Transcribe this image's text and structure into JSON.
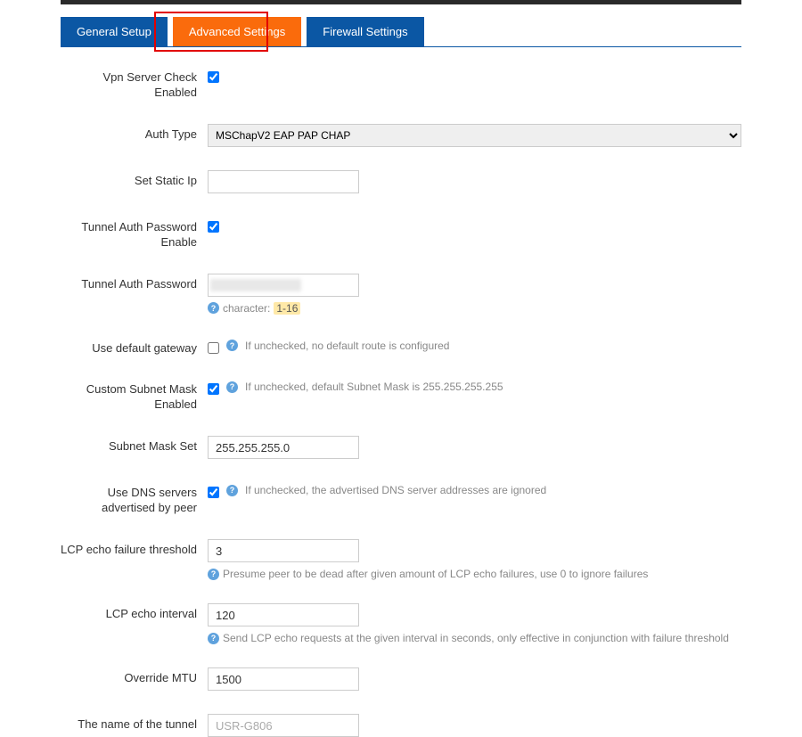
{
  "tabs": {
    "general": "General Setup",
    "advanced": "Advanced Settings",
    "firewall": "Firewall Settings"
  },
  "fields": {
    "vpn_check": {
      "label": "Vpn Server Check Enabled",
      "checked": true
    },
    "auth_type": {
      "label": "Auth Type",
      "value": "MSChapV2 EAP PAP CHAP"
    },
    "static_ip": {
      "label": "Set Static Ip",
      "value": ""
    },
    "tunnel_pw_enable": {
      "label": "Tunnel Auth Password Enable",
      "checked": true
    },
    "tunnel_pw": {
      "label": "Tunnel Auth Password",
      "hint_prefix": "character:",
      "hint_range": "1-16"
    },
    "default_gw": {
      "label": "Use default gateway",
      "checked": false,
      "hint": "If unchecked, no default route is configured"
    },
    "subnet_enabled": {
      "label": "Custom Subnet Mask Enabled",
      "checked": true,
      "hint": "If unchecked, default Subnet Mask is 255.255.255.255"
    },
    "subnet_set": {
      "label": "Subnet Mask Set",
      "value": "255.255.255.0"
    },
    "dns_peer": {
      "label": "Use DNS servers advertised by peer",
      "checked": true,
      "hint": "If unchecked, the advertised DNS server addresses are ignored"
    },
    "lcp_fail": {
      "label": "LCP echo failure threshold",
      "value": "3",
      "hint": "Presume peer to be dead after given amount of LCP echo failures, use 0 to ignore failures"
    },
    "lcp_interval": {
      "label": "LCP echo interval",
      "value": "120",
      "hint": "Send LCP echo requests at the given interval in seconds, only effective in conjunction with failure threshold"
    },
    "mtu": {
      "label": "Override MTU",
      "value": "1500"
    },
    "tunnel_name": {
      "label": "The name of the tunnel",
      "placeholder": "USR-G806"
    }
  }
}
